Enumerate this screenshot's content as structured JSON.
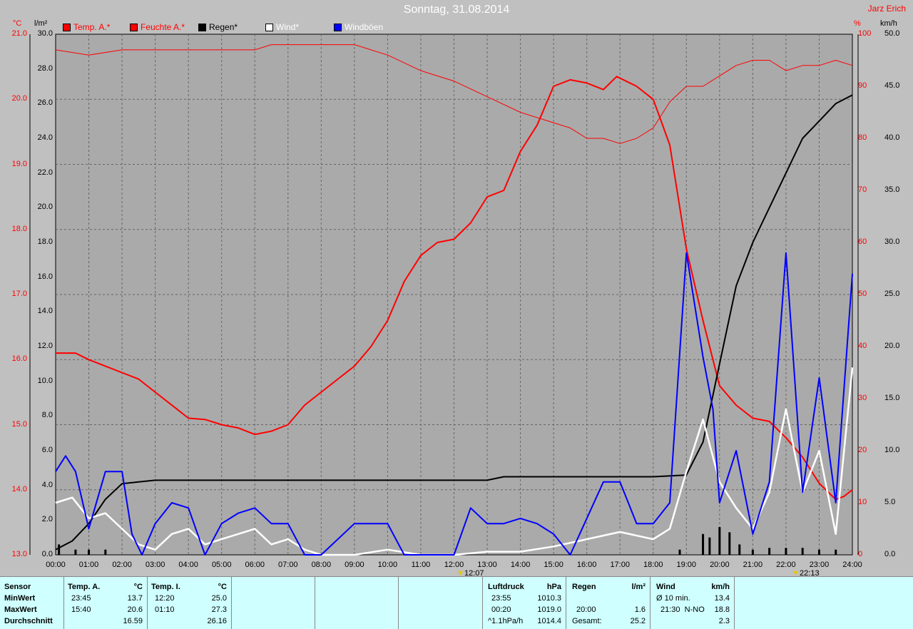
{
  "title": "Sonntag, 31.08.2014",
  "author": "Jarz Erich",
  "units": {
    "temp": "°C",
    "rain": "l/m²",
    "humidity": "%",
    "wind": "km/h"
  },
  "legend": [
    {
      "label": "Temp. A.*",
      "color": "#ff0000",
      "text_color": "#ff0000"
    },
    {
      "label": "Feuchte A.*",
      "color": "#ff0000",
      "text_color": "#ff0000"
    },
    {
      "label": "Regen*",
      "color": "#000000",
      "text_color": "#000000"
    },
    {
      "label": "Wind*",
      "color": "#ffffff",
      "text_color": "#ffffff"
    },
    {
      "label": "Windböen",
      "color": "#0000ff",
      "text_color": "#ffffff"
    }
  ],
  "markers": [
    {
      "time": "12:07",
      "hour": 12.12
    },
    {
      "time": "22:13",
      "hour": 22.22
    }
  ],
  "chart_data": {
    "type": "line",
    "x_ticks": [
      "00:00",
      "01:00",
      "02:00",
      "03:00",
      "04:00",
      "05:00",
      "06:00",
      "07:00",
      "08:00",
      "09:00",
      "10:00",
      "11:00",
      "12:00",
      "13:00",
      "14:00",
      "15:00",
      "16:00",
      "17:00",
      "18:00",
      "19:00",
      "20:00",
      "21:00",
      "22:00",
      "23:00",
      "24:00"
    ],
    "axes": {
      "temp": {
        "ticks": [
          "21.0",
          "20.0",
          "19.0",
          "18.0",
          "17.0",
          "16.0",
          "15.0",
          "14.0",
          "13.0"
        ],
        "range": [
          13.0,
          21.0
        ],
        "color": "#ff0000"
      },
      "rain": {
        "ticks": [
          "30.0",
          "28.0",
          "26.0",
          "24.0",
          "22.0",
          "20.0",
          "18.0",
          "16.0",
          "14.0",
          "12.0",
          "10.0",
          "8.0",
          "6.0",
          "4.0",
          "2.0",
          "0.0"
        ],
        "range": [
          0,
          30
        ],
        "color": "#000000"
      },
      "humidity": {
        "ticks": [
          "100",
          "90",
          "80",
          "70",
          "60",
          "50",
          "40",
          "30",
          "20",
          "10",
          "0"
        ],
        "range": [
          0,
          100
        ],
        "color": "#ff0000"
      },
      "wind": {
        "ticks": [
          "50.0",
          "45.0",
          "40.0",
          "35.0",
          "30.0",
          "25.0",
          "20.0",
          "15.0",
          "10.0",
          "5.0",
          "0.0"
        ],
        "range": [
          0,
          50
        ],
        "color": "#000000"
      }
    },
    "series": [
      {
        "name": "Temp. A.*",
        "axis": "temp",
        "color": "#ff0000",
        "width": 2,
        "points": [
          [
            0,
            16.1
          ],
          [
            0.6,
            16.1
          ],
          [
            1,
            16.0
          ],
          [
            1.5,
            15.9
          ],
          [
            2,
            15.8
          ],
          [
            2.5,
            15.7
          ],
          [
            3,
            15.5
          ],
          [
            3.5,
            15.3
          ],
          [
            4,
            15.1
          ],
          [
            4.5,
            15.08
          ],
          [
            5,
            15.0
          ],
          [
            5.5,
            14.95
          ],
          [
            6,
            14.85
          ],
          [
            6.5,
            14.9
          ],
          [
            7,
            15.0
          ],
          [
            7.5,
            15.3
          ],
          [
            8,
            15.5
          ],
          [
            8.5,
            15.7
          ],
          [
            9,
            15.9
          ],
          [
            9.5,
            16.2
          ],
          [
            10,
            16.6
          ],
          [
            10.5,
            17.2
          ],
          [
            11,
            17.6
          ],
          [
            11.5,
            17.8
          ],
          [
            12,
            17.85
          ],
          [
            12.5,
            18.1
          ],
          [
            13,
            18.5
          ],
          [
            13.5,
            18.6
          ],
          [
            14,
            19.2
          ],
          [
            14.5,
            19.6
          ],
          [
            15,
            20.2
          ],
          [
            15.5,
            20.3
          ],
          [
            16,
            20.25
          ],
          [
            16.5,
            20.15
          ],
          [
            16.9,
            20.35
          ],
          [
            17.5,
            20.2
          ],
          [
            18,
            20.0
          ],
          [
            18.5,
            19.3
          ],
          [
            19,
            17.7
          ],
          [
            19.5,
            16.6
          ],
          [
            20,
            15.6
          ],
          [
            20.5,
            15.3
          ],
          [
            21,
            15.1
          ],
          [
            21.5,
            15.05
          ],
          [
            22,
            14.8
          ],
          [
            22.5,
            14.5
          ],
          [
            23,
            14.1
          ],
          [
            23.5,
            13.85
          ],
          [
            23.75,
            13.9
          ],
          [
            24,
            14.0
          ]
        ]
      },
      {
        "name": "Feuchte A.*",
        "axis": "humidity",
        "color": "#ff0000",
        "width": 1,
        "points": [
          [
            0,
            97
          ],
          [
            1,
            96
          ],
          [
            2,
            97
          ],
          [
            3,
            97
          ],
          [
            4,
            97
          ],
          [
            5,
            97
          ],
          [
            6,
            97
          ],
          [
            6.5,
            98
          ],
          [
            7,
            98
          ],
          [
            8,
            98
          ],
          [
            9,
            98
          ],
          [
            10,
            96
          ],
          [
            11,
            93
          ],
          [
            12,
            91
          ],
          [
            13,
            88
          ],
          [
            14,
            85
          ],
          [
            15,
            83
          ],
          [
            15.5,
            82
          ],
          [
            16,
            80
          ],
          [
            16.5,
            80
          ],
          [
            17,
            79
          ],
          [
            17.5,
            80
          ],
          [
            18,
            82
          ],
          [
            18.5,
            87
          ],
          [
            19,
            90
          ],
          [
            19.5,
            90
          ],
          [
            20,
            92
          ],
          [
            20.5,
            94
          ],
          [
            21,
            95
          ],
          [
            21.5,
            95
          ],
          [
            22,
            93
          ],
          [
            22.5,
            94
          ],
          [
            23,
            94
          ],
          [
            23.5,
            95
          ],
          [
            24,
            94
          ]
        ]
      },
      {
        "name": "Regen*",
        "axis": "rain",
        "color": "#000000",
        "width": 2,
        "points": [
          [
            0,
            0.3
          ],
          [
            0.5,
            0.8
          ],
          [
            1,
            1.8
          ],
          [
            1.5,
            3.2
          ],
          [
            2,
            4.1
          ],
          [
            2.5,
            4.2
          ],
          [
            3,
            4.3
          ],
          [
            6,
            4.3
          ],
          [
            9,
            4.3
          ],
          [
            12,
            4.3
          ],
          [
            13,
            4.3
          ],
          [
            13.5,
            4.5
          ],
          [
            16,
            4.5
          ],
          [
            18,
            4.5
          ],
          [
            19,
            4.6
          ],
          [
            19.5,
            6.5
          ],
          [
            20,
            11
          ],
          [
            20.5,
            15.5
          ],
          [
            21,
            18
          ],
          [
            21.5,
            20
          ],
          [
            22,
            22
          ],
          [
            22.5,
            24
          ],
          [
            23,
            25
          ],
          [
            23.5,
            26
          ],
          [
            24,
            26.5
          ]
        ]
      },
      {
        "name": "Wind*",
        "axis": "wind",
        "color": "#ffffff",
        "width": 2.5,
        "points": [
          [
            0,
            5
          ],
          [
            0.5,
            5.5
          ],
          [
            1,
            3.5
          ],
          [
            1.5,
            4
          ],
          [
            2,
            2.5
          ],
          [
            2.5,
            1
          ],
          [
            3,
            0.5
          ],
          [
            3.5,
            2
          ],
          [
            4,
            2.5
          ],
          [
            4.5,
            1
          ],
          [
            5,
            1.5
          ],
          [
            5.5,
            2
          ],
          [
            6,
            2.5
          ],
          [
            6.5,
            1
          ],
          [
            7,
            1.5
          ],
          [
            7.5,
            0.5
          ],
          [
            8,
            0
          ],
          [
            9,
            0
          ],
          [
            10,
            0.5
          ],
          [
            11,
            0
          ],
          [
            12,
            0
          ],
          [
            13,
            0.3
          ],
          [
            14,
            0.3
          ],
          [
            15,
            0.8
          ],
          [
            16,
            1.5
          ],
          [
            17,
            2.2
          ],
          [
            18,
            1.5
          ],
          [
            18.5,
            2.5
          ],
          [
            19,
            8
          ],
          [
            19.5,
            13
          ],
          [
            20,
            7
          ],
          [
            20.5,
            4.5
          ],
          [
            21,
            2.5
          ],
          [
            21.5,
            6
          ],
          [
            22,
            14
          ],
          [
            22.5,
            6
          ],
          [
            23,
            10
          ],
          [
            23.5,
            2
          ],
          [
            24,
            18
          ]
        ]
      },
      {
        "name": "Windböen",
        "axis": "wind",
        "color": "#0000ff",
        "width": 2,
        "points": [
          [
            0,
            8
          ],
          [
            0.3,
            9.5
          ],
          [
            0.6,
            8
          ],
          [
            1,
            2.5
          ],
          [
            1.5,
            8
          ],
          [
            2,
            8
          ],
          [
            2.3,
            2
          ],
          [
            2.6,
            0
          ],
          [
            3,
            3
          ],
          [
            3.5,
            5
          ],
          [
            4,
            4.5
          ],
          [
            4.5,
            0
          ],
          [
            5,
            3
          ],
          [
            5.5,
            4
          ],
          [
            6,
            4.5
          ],
          [
            6.5,
            3
          ],
          [
            7,
            3
          ],
          [
            7.5,
            0
          ],
          [
            8,
            0
          ],
          [
            9,
            3
          ],
          [
            10,
            3
          ],
          [
            10.5,
            0
          ],
          [
            11,
            0
          ],
          [
            12,
            0
          ],
          [
            12.5,
            4.5
          ],
          [
            13,
            3
          ],
          [
            13.5,
            3
          ],
          [
            14,
            3.5
          ],
          [
            14.5,
            3
          ],
          [
            15,
            2
          ],
          [
            15.5,
            0
          ],
          [
            16,
            3.5
          ],
          [
            16.5,
            7
          ],
          [
            17,
            7
          ],
          [
            17.5,
            3
          ],
          [
            18,
            3
          ],
          [
            18.5,
            5
          ],
          [
            19,
            29
          ],
          [
            19.5,
            19
          ],
          [
            19.8,
            14
          ],
          [
            20,
            5
          ],
          [
            20.5,
            10
          ],
          [
            21,
            2
          ],
          [
            21.5,
            7
          ],
          [
            22,
            29
          ],
          [
            22.5,
            6
          ],
          [
            23,
            17
          ],
          [
            23.5,
            5
          ],
          [
            24,
            27
          ]
        ]
      }
    ],
    "rain_bars_hours": [
      [
        0.1,
        0.6
      ],
      [
        0.6,
        0.3
      ],
      [
        1,
        0.3
      ],
      [
        1.5,
        0.3
      ],
      [
        18.8,
        0.3
      ],
      [
        19.5,
        1.2
      ],
      [
        19.7,
        1.0
      ],
      [
        20,
        1.6
      ],
      [
        20.3,
        1.3
      ],
      [
        20.6,
        0.6
      ],
      [
        21,
        0.3
      ],
      [
        21.5,
        0.4
      ],
      [
        22,
        0.4
      ],
      [
        22.5,
        0.4
      ],
      [
        23,
        0.3
      ],
      [
        23.5,
        0.3
      ]
    ]
  },
  "table": {
    "sensor": {
      "header": "Sensor",
      "rows": [
        "MinWert",
        "MaxWert",
        "Durchschnitt"
      ]
    },
    "temp_a": {
      "header": "Temp. A.",
      "unit": "°C",
      "rows": [
        [
          "23:45",
          "13.7"
        ],
        [
          "15:40",
          "20.6"
        ],
        [
          "",
          "16.59"
        ]
      ]
    },
    "temp_i": {
      "header": "Temp. I.",
      "unit": "°C",
      "rows": [
        [
          "12:20",
          "25.0"
        ],
        [
          "01:10",
          "27.3"
        ],
        [
          "",
          "26.16"
        ]
      ]
    },
    "pressure": {
      "header": "Luftdruck",
      "unit": "hPa",
      "rows": [
        [
          "23:55",
          "1010.3"
        ],
        [
          "00:20",
          "1019.0"
        ],
        [
          "^1.1hPa/h",
          "1014.4"
        ]
      ]
    },
    "rain": {
      "header": "Regen",
      "unit": "l/m²",
      "rows": [
        [
          "",
          ""
        ],
        [
          "20:00",
          "1.6"
        ],
        [
          "Gesamt:",
          "25.2"
        ]
      ]
    },
    "wind": {
      "header": "Wind",
      "unit": "km/h",
      "rows": [
        [
          "Ø 10 min.",
          "13.4"
        ],
        [
          "21:30  N-NO",
          "18.8"
        ],
        [
          "",
          "2.3"
        ]
      ]
    }
  }
}
